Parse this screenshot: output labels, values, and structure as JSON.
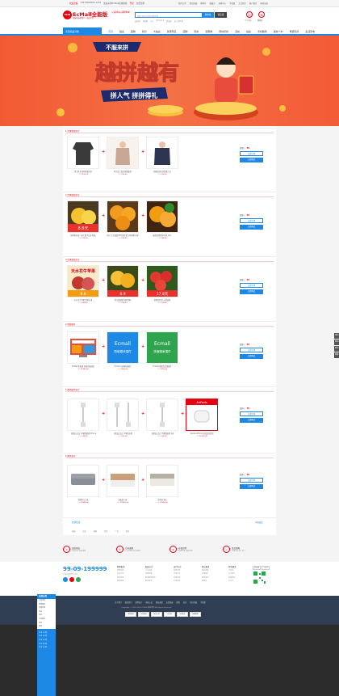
{
  "topbar": {
    "left": [
      "欢迎光临",
      "13875000000-1234",
      "欢迎来到ECMall商城模板",
      "登录",
      "免费注册"
    ],
    "right": [
      "我的订单",
      "我的商城",
      "购物车",
      "收藏夹",
      "商家中心",
      "手机版",
      "关注我们",
      "客户服务",
      "网站导航"
    ]
  },
  "header": {
    "logo_mark": "ECM",
    "logo_name": "EcMall全能版",
    "logo_sub": "商城系统多用户一站式平台",
    "slogan": "让品质生活更简单",
    "search_placeholder": "搜索 商品/店铺/品牌名称",
    "search_btn": "搜本站",
    "store_btn": "搜店铺",
    "hotwords": [
      "连衣裙",
      "羽绒服",
      "口红",
      "iphone X",
      "保温杯",
      "床上四件套"
    ],
    "icons": [
      {
        "icon": "user-icon",
        "label": "个人中心"
      },
      {
        "icon": "cart-icon",
        "label": "购物车"
      }
    ]
  },
  "nav": {
    "category": "全部商品分类",
    "items": [
      "首页",
      "拍卖",
      "团购",
      "积分",
      "大拍卖",
      "优惠专区",
      "团购",
      "秒杀",
      "优惠券",
      "限时折扣",
      "活动",
      "拍卖",
      "手机数码",
      "美妆个护",
      "母婴玩具",
      "生活家电"
    ],
    "active_index": 0
  },
  "banner": {
    "tag": "不服来拼",
    "headline": "越拼越有",
    "subline": "拼人气 拼拼得礼"
  },
  "groups": [
    {
      "title": "1 优惠套装组合",
      "price_label": "套餐价：",
      "price": "¥0",
      "btn1": "立即下单",
      "btn2": "立即购买",
      "products": [
        {
          "name": "男士秋冬加厚保暖内衣",
          "sold": "0",
          "price": "¥130.00"
        },
        {
          "name": "时尚女士秋冬保暖套装",
          "sold": "0",
          "price": "¥99.00"
        },
        {
          "name": "纯棉加绒打底保暖上衣",
          "sold": "0",
          "price": "¥59.00"
        }
      ]
    },
    {
      "title": "2 优惠套装组合",
      "price_label": "套餐价：",
      "price": "¥0",
      "btn1": "立即下单",
      "btn2": "立即购买",
      "products": [
        {
          "name": "新鲜黄柠檬一级大果 5斤装 精选",
          "sold": "0",
          "price": "¥29.90"
        },
        {
          "name": "四川 正宗爱媛38号果冻橙 当季新鲜水果",
          "sold": "0",
          "price": "¥39.90"
        },
        {
          "name": "赣南脐橙新鲜水果 10斤",
          "sold": "0",
          "price": "¥49.00"
        }
      ],
      "badges": [
        "8.8元",
        "5.9斤"
      ]
    },
    {
      "title": "3 优惠套装组合",
      "price_label": "套餐价：",
      "price": "¥0",
      "btn1": "立即下单",
      "btn2": "立即购买",
      "products": [
        {
          "name": "天水花牛苹果 新鲜水果",
          "sold": "0",
          "price": "¥49.00"
        },
        {
          "name": "四川爱媛果冻橙 新鲜",
          "sold": "0",
          "price": "¥39.90"
        },
        {
          "name": "新鲜西红柿 自然成熟",
          "sold": "0",
          "price": "¥19.90"
        }
      ],
      "top_text": "天水花牛苹果",
      "badges": [
        "8.8",
        "8.9",
        "17.8元"
      ]
    },
    {
      "title": "4 增值服务",
      "price_label": "套餐价：",
      "price": "¥0",
      "btn1": "立即下单",
      "btn2": "立即购买",
      "products": [
        {
          "name": "ECMall全能版 商城系统模板",
          "sold": "0",
          "price": "¥1999.00"
        },
        {
          "name": "Ecmall 功能模块插件",
          "sold": "0",
          "price": "¥599.00"
        },
        {
          "name": "Ecmall 数据库迁移插件",
          "sold": "0",
          "price": "¥399.00"
        }
      ],
      "plugin1": "Ecmall",
      "plugin1_sub": "短信模块插件",
      "plugin2": "Ecmall",
      "plugin2_sub": "快速搬家插件"
    },
    {
      "title": "5 数码配件组合",
      "price_label": "套餐价：",
      "price": "¥0",
      "btn1": "立即下单",
      "btn2": "立即购买",
      "products": [
        {
          "name": "【原装正品】苹果数据线 iPhone",
          "sold": "0",
          "price": "¥39.00"
        },
        {
          "name": "【原装正品】苹果快充线",
          "sold": "0",
          "price": "¥59.00"
        },
        {
          "name": "【原装正品】苹果数据线 1米",
          "sold": "0",
          "price": "¥39.00"
        },
        {
          "name": "Apple AirPods 无线蓝牙耳机",
          "sold": "0",
          "price": "¥1099.00"
        }
      ],
      "airpods_label": "AirPods"
    },
    {
      "title": "6 家具组合",
      "price_label": "套餐价：",
      "price": "¥0",
      "btn1": "立即下单",
      "btn2": "立即购买",
      "products": [
        {
          "name": "北欧布艺沙发",
          "sold": "0",
          "price": "¥2999.00"
        },
        {
          "name": "真皮双人床",
          "sold": "0",
          "price": "¥3999.00"
        },
        {
          "name": "简约实木床",
          "sold": "0",
          "price": "¥2599.00"
        }
      ]
    }
  ],
  "friend_links": {
    "title": "友情链接",
    "more": "申请链接",
    "items": [
      "商城",
      "拍卖",
      "团购",
      "积分",
      "广告",
      "秒杀"
    ]
  },
  "services": [
    {
      "icon": "Y",
      "t1": "品质保证",
      "t2": "正品行货 品质保障"
    },
    {
      "icon": "7",
      "t1": "七天退换",
      "t2": "7天无理由 放心购物"
    },
    {
      "icon": "¥",
      "t1": "价格实惠",
      "t2": "实惠价格 品质好物"
    },
    {
      "icon": "✓",
      "t1": "正品保障",
      "t2": "全场正品 假一赔十"
    }
  ],
  "footer": {
    "phone": "99-09-199999",
    "email": "xxxx@163.com",
    "cols": [
      {
        "head": "购物指南",
        "items": [
          "购物流程",
          "会员介绍",
          "常见问题",
          "联系客服"
        ]
      },
      {
        "head": "配送方式",
        "items": [
          "上门自提",
          "快速运输",
          "配送服务查询",
          "特别说明"
        ]
      },
      {
        "head": "支付方式",
        "items": [
          "货到付款",
          "在线支付",
          "分期付款",
          "公司转账"
        ]
      },
      {
        "head": "售后服务",
        "items": [
          "售后政策",
          "价格保护",
          "退款说明",
          "退换货"
        ]
      },
      {
        "head": "特色服务",
        "items": [
          "夺宝岛",
          "DIY装机",
          "延保服务",
          "礼品卡"
        ]
      }
    ],
    "qr_tabs": [
      "公众号",
      "小程序"
    ],
    "links": [
      "关于我们",
      "联系我们",
      "招聘英才",
      "商家入驻",
      "隐私政策",
      "友情链接",
      "团购",
      "拍卖",
      "积分商城",
      "手机版"
    ],
    "copyright": "Copyright © 2018-2025 ECMall 版权所有 All Rights Reserved",
    "badges": [
      "诚信网站",
      "可信网站",
      "安全认证",
      "支付宝",
      "360安全",
      "网络警察"
    ]
  },
  "side_category": {
    "title": "全部分类",
    "items": [
      "女装男装",
      "鞋靴箱包",
      "母婴玩具",
      "食品",
      "美妆",
      "手机数码",
      "家电",
      "家居"
    ],
    "extra": [
      "TOP 10 热",
      "TOP 20 热",
      "TOP 30 热",
      "TOP 40 热",
      "TOP 50 热"
    ]
  },
  "right_bar": [
    "顶部",
    "客服",
    "购物",
    "收藏"
  ]
}
